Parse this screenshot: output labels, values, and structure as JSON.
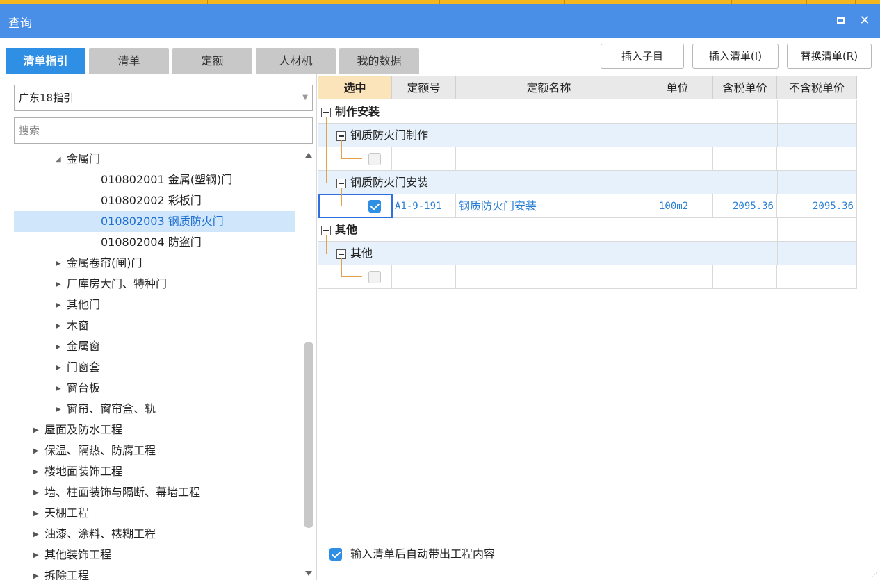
{
  "window": {
    "title": "查询"
  },
  "tabs": [
    {
      "label": "清单指引",
      "active": true
    },
    {
      "label": "清单"
    },
    {
      "label": "定额"
    },
    {
      "label": "人材机"
    },
    {
      "label": "我的数据"
    }
  ],
  "buttons": {
    "insert_child": "插入子目",
    "insert_list": "插入清单(I)",
    "replace_list": "替换清单(R)"
  },
  "left": {
    "guide_select": "广东18指引",
    "search_placeholder": "搜索",
    "tree": [
      {
        "label": "金属门",
        "expanded": true
      },
      {
        "label": "010802001  金属(塑钢)门"
      },
      {
        "label": "010802002  彩板门"
      },
      {
        "label": "010802003  钢质防火门",
        "selected": true
      },
      {
        "label": "010802004  防盗门"
      },
      {
        "label": "金属卷帘(闸)门"
      },
      {
        "label": "厂库房大门、特种门"
      },
      {
        "label": "其他门"
      },
      {
        "label": "木窗"
      },
      {
        "label": "金属窗"
      },
      {
        "label": "门窗套"
      },
      {
        "label": "窗台板"
      },
      {
        "label": "窗帘、窗帘盒、轨"
      },
      {
        "label": "屋面及防水工程"
      },
      {
        "label": "保温、隔热、防腐工程"
      },
      {
        "label": "楼地面装饰工程"
      },
      {
        "label": "墙、柱面装饰与隔断、幕墙工程"
      },
      {
        "label": "天棚工程"
      },
      {
        "label": "油漆、涂料、裱糊工程"
      },
      {
        "label": "其他装饰工程"
      },
      {
        "label": "拆除工程"
      }
    ]
  },
  "grid": {
    "headers": [
      "选中",
      "定额号",
      "定额名称",
      "单位",
      "含税单价",
      "不含税单价"
    ],
    "groups": {
      "g1": "制作安装",
      "g1a": "钢质防火门制作",
      "g1b": "钢质防火门安装",
      "g2": "其他",
      "g2a": "其他"
    },
    "row_item": {
      "selected": true,
      "code": "A1-9-191",
      "name": "钢质防火门安装",
      "unit": "100m2",
      "price_tax": "2095.36",
      "price_notax": "2095.36"
    }
  },
  "options": {
    "auto_bring_content": {
      "label": "输入清单后自动带出工程内容",
      "checked": true
    }
  },
  "colors": {
    "accent": "#2f8fe4",
    "titlebar": "#4a8fe7",
    "link": "#2a7fd4"
  }
}
